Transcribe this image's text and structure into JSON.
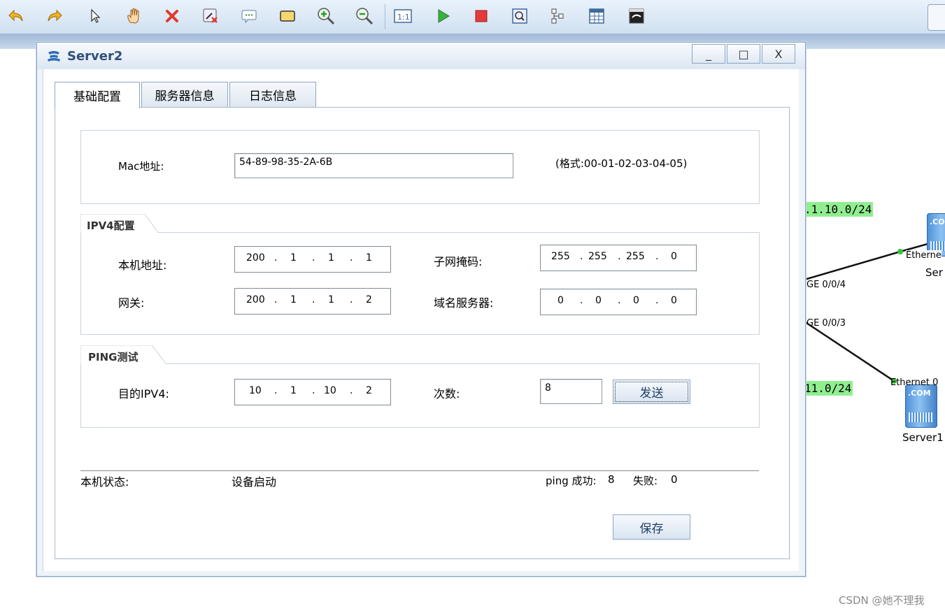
{
  "toolbar": {
    "icons": [
      "undo-icon",
      "redo-icon",
      "pointer-icon",
      "hand-icon",
      "delete-icon",
      "delete-link-icon",
      "text-icon",
      "rectangle-icon",
      "zoom-in-icon",
      "zoom-out-icon",
      "fit-icon",
      "start-icon",
      "stop-icon",
      "capture-icon",
      "topology-icon",
      "grid-icon",
      "terminal-icon"
    ]
  },
  "topology": {
    "net_top": ".1.10.0/24",
    "net_bottom": "11.0/24",
    "port_ge4": "GE 0/0/4",
    "port_ge3": "GE 0/0/3",
    "port_eth_top": "Etherne",
    "port_eth_bottom": "Ethernet 0",
    "server_top_label": "Ser",
    "server_bottom_label": "Server1",
    "server_badge": ".COM"
  },
  "dialog": {
    "title": "Server2",
    "minimize": "_",
    "maximize": "□",
    "close": "X",
    "tabs": [
      "基础配置",
      "服务器信息",
      "日志信息"
    ],
    "mac": {
      "label": "Mac地址:",
      "value": "54-89-98-35-2A-6B",
      "hint": "(格式:00-01-02-03-04-05)"
    },
    "ipv4": {
      "group_title": "IPV4配置",
      "local_label": "本机地址:",
      "local_ip": [
        "200",
        "1",
        "1",
        "1"
      ],
      "mask_label": "子网掩码:",
      "mask": [
        "255",
        "255",
        "255",
        "0"
      ],
      "gateway_label": "网关:",
      "gateway": [
        "200",
        "1",
        "1",
        "2"
      ],
      "dns_label": "域名服务器:",
      "dns": [
        "0",
        "0",
        "0",
        "0"
      ]
    },
    "ping": {
      "group_title": "PING测试",
      "target_label": "目的IPV4:",
      "target": [
        "10",
        "1",
        "10",
        "2"
      ],
      "count_label": "次数:",
      "count": "8",
      "send_label": "发送"
    },
    "status": {
      "label": "本机状态:",
      "value": "设备启动",
      "ping_success_label": "ping 成功:",
      "ping_success": "8",
      "fail_label": "失败:",
      "fail": "0"
    },
    "save_label": "保存"
  },
  "watermark": "CSDN @她不理我",
  "colors": {
    "net_label_bg": "#90ee90",
    "title_color": "#30507a",
    "link_dot": "#3cc13c"
  }
}
